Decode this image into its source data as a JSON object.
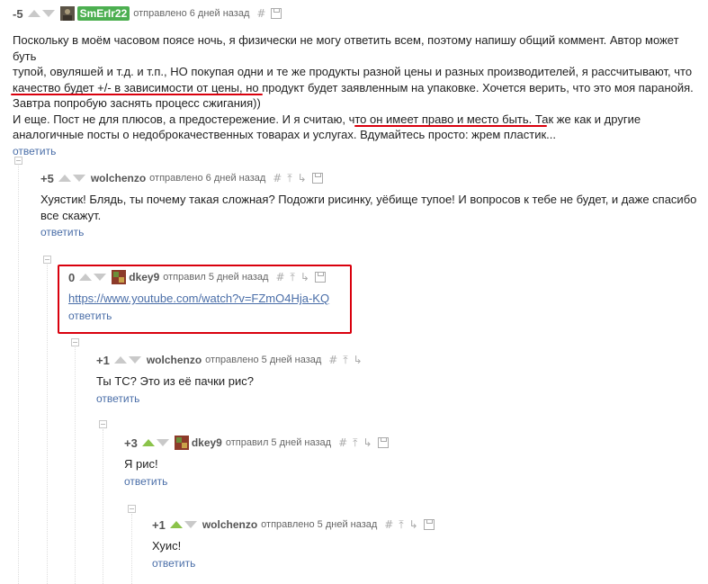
{
  "comments": [
    {
      "rating": "-5",
      "author": "SmErIr22",
      "time": "отправлено 6 дней назад",
      "lines": [
        "Поскольку в моём часовом поясе ночь, я физически не могу ответить всем, поэтому напишу общий коммент. Автор может буть",
        "тупой, овуляшей и т.д. и т.п., НО покупая одни и те же продукты разной цены и разных производителей, я рассчитывают, что",
        "качество будет +/- в зависимости от цены, но продукт будет заявленным на упаковке. Хочется верить, что это моя паранойя.",
        "Завтра попробую заснять процесс сжигания))",
        "И еще. Пост не для плюсов, а предостережение. И я считаю, что он имеет право и место быть. Так же как и другие",
        "аналогичные посты о недоброкачественных товарах и услугах. Вдумайтесь просто: жрем пластик..."
      ],
      "reply": "ответить"
    },
    {
      "rating": "+5",
      "author": "wolchenzo",
      "time": "отправлено 6 дней назад",
      "lines": [
        "Хуястик! Блядь, ты почему такая сложная? Подожги рисинку, уёбище тупое! И вопросов к тебе не будет, и даже спасибо",
        "все скажут."
      ],
      "reply": "ответить"
    },
    {
      "rating": "0",
      "author": "dkey9",
      "time": "отправил 5 дней назад",
      "link": "https://www.youtube.com/watch?v=FZmO4Hja-KQ",
      "reply": "ответить"
    },
    {
      "rating": "+1",
      "author": "wolchenzo",
      "time": "отправлено 5 дней назад",
      "lines": [
        "Ты ТС? Это из её пачки рис?"
      ],
      "reply": "ответить"
    },
    {
      "rating": "+3",
      "author": "dkey9",
      "time": "отправил 5 дней назад",
      "lines": [
        "Я рис!"
      ],
      "reply": "ответить"
    },
    {
      "rating": "+1",
      "author": "wolchenzo",
      "time": "отправлено 5 дней назад",
      "lines": [
        "Хуис!"
      ],
      "reply": "ответить"
    }
  ],
  "icons": [
    "upvote-arrow-icon",
    "downvote-arrow-icon",
    "hash-link-icon",
    "parent-link-icon",
    "tree-icon",
    "save-icon",
    "collapse-icon"
  ],
  "colors": {
    "accent_link": "#4a6ea8",
    "highlight": "#d9000d",
    "upvote_active": "#8bc34a",
    "badge": "#4caf50"
  }
}
